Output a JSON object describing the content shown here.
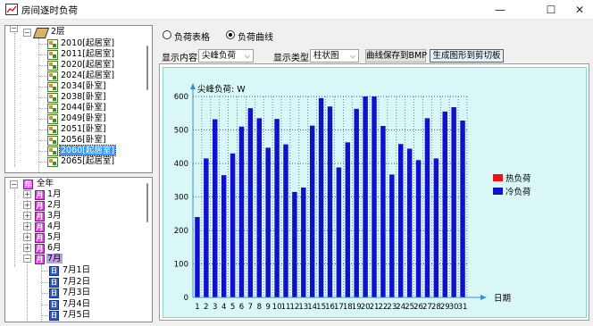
{
  "window": {
    "title": "房间逐时负荷"
  },
  "floor_tree": {
    "floor_label": "2层",
    "rooms": [
      "2010[起居室]",
      "2011[起居室]",
      "2020[起居室]",
      "2024[起居室]",
      "2034[卧室]",
      "2038[卧室]",
      "2044[卧室]",
      "2049[卧室]",
      "2051[卧室]",
      "2056[卧室]",
      "2060[起居室]",
      "2065[起居室]"
    ],
    "selected_room": "2060[起居室]"
  },
  "time_tree": {
    "year_label": "全年",
    "year_icon": "年",
    "month_icon": "月",
    "day_icon": "日",
    "months": [
      "1月",
      "2月",
      "3月",
      "4月",
      "5月",
      "6月",
      "7月"
    ],
    "selected_month": "7月",
    "days": [
      "7月1日",
      "7月2日",
      "7月3日",
      "7月4日",
      "7月5日"
    ]
  },
  "view_mode": {
    "table_label": "负荷表格",
    "curve_label": "负荷曲线",
    "selected": "curve"
  },
  "toolbar": {
    "content_label": "显示内容",
    "content_value": "尖峰负荷",
    "type_label": "显示类型",
    "type_value": "柱状图",
    "save_bmp_label": "曲线保存到BMP",
    "clipboard_label": "生成图形到剪切板"
  },
  "colors": {
    "heat": "#ee1111",
    "cool": "#1111cc",
    "chart_bg": "#d9f7f6",
    "axis": "#3a8fd6"
  },
  "chart_data": {
    "type": "bar",
    "ylabel": "尖峰负荷: W",
    "xlabel": "日期",
    "ylim": [
      0,
      600
    ],
    "yticks": [
      0,
      100,
      200,
      300,
      400,
      500,
      600
    ],
    "categories": [
      "1",
      "2",
      "3",
      "4",
      "5",
      "6",
      "7",
      "8",
      "9",
      "10",
      "11",
      "12",
      "13",
      "14",
      "15",
      "16",
      "17",
      "18",
      "19",
      "20",
      "21",
      "22",
      "23",
      "24",
      "25",
      "26",
      "27",
      "28",
      "29",
      "30",
      "31"
    ],
    "legend": [
      "热负荷",
      "冷负荷"
    ],
    "legend_position": "right",
    "series": [
      {
        "name": "热负荷",
        "values": [
          0,
          0,
          0,
          0,
          0,
          0,
          0,
          0,
          0,
          0,
          0,
          0,
          0,
          0,
          0,
          0,
          0,
          0,
          0,
          0,
          0,
          0,
          0,
          0,
          0,
          0,
          0,
          0,
          0,
          0,
          0
        ]
      },
      {
        "name": "冷负荷",
        "values": [
          240,
          415,
          532,
          365,
          430,
          510,
          565,
          535,
          447,
          533,
          457,
          315,
          328,
          513,
          595,
          570,
          388,
          463,
          563,
          600,
          600,
          512,
          367,
          458,
          444,
          410,
          535,
          415,
          555,
          568,
          528
        ]
      }
    ]
  }
}
